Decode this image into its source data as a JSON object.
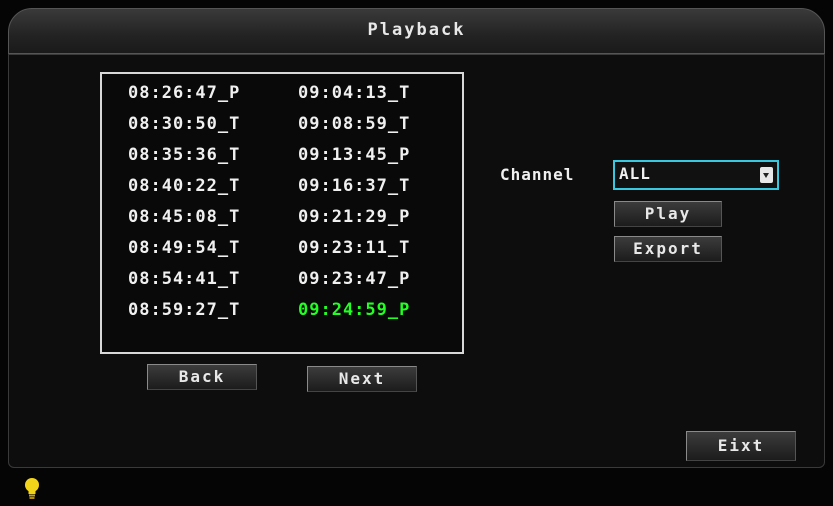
{
  "window": {
    "title": "Playback"
  },
  "files": {
    "left": [
      "08:26:47_P",
      "08:30:50_T",
      "08:35:36_T",
      "08:40:22_T",
      "08:45:08_T",
      "08:49:54_T",
      "08:54:41_T",
      "08:59:27_T"
    ],
    "right": [
      "09:04:13_T",
      "09:08:59_T",
      "09:13:45_P",
      "09:16:37_T",
      "09:21:29_P",
      "09:23:11_T",
      "09:23:47_P",
      "09:24:59_P"
    ],
    "selected": "09:24:59_P",
    "selected_color": "#22ff22"
  },
  "nav": {
    "back_label": "Back",
    "next_label": "Next"
  },
  "channel": {
    "label": "Channel",
    "value": "ALL",
    "focus_color": "#38c8e0"
  },
  "actions": {
    "play_label": "Play",
    "export_label": "Export",
    "exit_label": "Eixt"
  },
  "status": {
    "indicator_icon": "lightbulb-icon",
    "indicator_color": "#f2d51a"
  }
}
